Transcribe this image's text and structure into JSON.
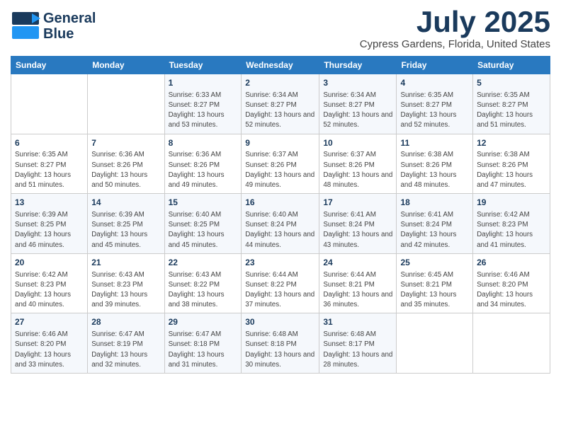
{
  "header": {
    "logo_line1": "General",
    "logo_line2": "Blue",
    "month": "July 2025",
    "location": "Cypress Gardens, Florida, United States"
  },
  "weekdays": [
    "Sunday",
    "Monday",
    "Tuesday",
    "Wednesday",
    "Thursday",
    "Friday",
    "Saturday"
  ],
  "weeks": [
    [
      {
        "day": "",
        "info": ""
      },
      {
        "day": "",
        "info": ""
      },
      {
        "day": "1",
        "info": "Sunrise: 6:33 AM\nSunset: 8:27 PM\nDaylight: 13 hours and 53 minutes."
      },
      {
        "day": "2",
        "info": "Sunrise: 6:34 AM\nSunset: 8:27 PM\nDaylight: 13 hours and 52 minutes."
      },
      {
        "day": "3",
        "info": "Sunrise: 6:34 AM\nSunset: 8:27 PM\nDaylight: 13 hours and 52 minutes."
      },
      {
        "day": "4",
        "info": "Sunrise: 6:35 AM\nSunset: 8:27 PM\nDaylight: 13 hours and 52 minutes."
      },
      {
        "day": "5",
        "info": "Sunrise: 6:35 AM\nSunset: 8:27 PM\nDaylight: 13 hours and 51 minutes."
      }
    ],
    [
      {
        "day": "6",
        "info": "Sunrise: 6:35 AM\nSunset: 8:27 PM\nDaylight: 13 hours and 51 minutes."
      },
      {
        "day": "7",
        "info": "Sunrise: 6:36 AM\nSunset: 8:26 PM\nDaylight: 13 hours and 50 minutes."
      },
      {
        "day": "8",
        "info": "Sunrise: 6:36 AM\nSunset: 8:26 PM\nDaylight: 13 hours and 49 minutes."
      },
      {
        "day": "9",
        "info": "Sunrise: 6:37 AM\nSunset: 8:26 PM\nDaylight: 13 hours and 49 minutes."
      },
      {
        "day": "10",
        "info": "Sunrise: 6:37 AM\nSunset: 8:26 PM\nDaylight: 13 hours and 48 minutes."
      },
      {
        "day": "11",
        "info": "Sunrise: 6:38 AM\nSunset: 8:26 PM\nDaylight: 13 hours and 48 minutes."
      },
      {
        "day": "12",
        "info": "Sunrise: 6:38 AM\nSunset: 8:26 PM\nDaylight: 13 hours and 47 minutes."
      }
    ],
    [
      {
        "day": "13",
        "info": "Sunrise: 6:39 AM\nSunset: 8:25 PM\nDaylight: 13 hours and 46 minutes."
      },
      {
        "day": "14",
        "info": "Sunrise: 6:39 AM\nSunset: 8:25 PM\nDaylight: 13 hours and 45 minutes."
      },
      {
        "day": "15",
        "info": "Sunrise: 6:40 AM\nSunset: 8:25 PM\nDaylight: 13 hours and 45 minutes."
      },
      {
        "day": "16",
        "info": "Sunrise: 6:40 AM\nSunset: 8:24 PM\nDaylight: 13 hours and 44 minutes."
      },
      {
        "day": "17",
        "info": "Sunrise: 6:41 AM\nSunset: 8:24 PM\nDaylight: 13 hours and 43 minutes."
      },
      {
        "day": "18",
        "info": "Sunrise: 6:41 AM\nSunset: 8:24 PM\nDaylight: 13 hours and 42 minutes."
      },
      {
        "day": "19",
        "info": "Sunrise: 6:42 AM\nSunset: 8:23 PM\nDaylight: 13 hours and 41 minutes."
      }
    ],
    [
      {
        "day": "20",
        "info": "Sunrise: 6:42 AM\nSunset: 8:23 PM\nDaylight: 13 hours and 40 minutes."
      },
      {
        "day": "21",
        "info": "Sunrise: 6:43 AM\nSunset: 8:23 PM\nDaylight: 13 hours and 39 minutes."
      },
      {
        "day": "22",
        "info": "Sunrise: 6:43 AM\nSunset: 8:22 PM\nDaylight: 13 hours and 38 minutes."
      },
      {
        "day": "23",
        "info": "Sunrise: 6:44 AM\nSunset: 8:22 PM\nDaylight: 13 hours and 37 minutes."
      },
      {
        "day": "24",
        "info": "Sunrise: 6:44 AM\nSunset: 8:21 PM\nDaylight: 13 hours and 36 minutes."
      },
      {
        "day": "25",
        "info": "Sunrise: 6:45 AM\nSunset: 8:21 PM\nDaylight: 13 hours and 35 minutes."
      },
      {
        "day": "26",
        "info": "Sunrise: 6:46 AM\nSunset: 8:20 PM\nDaylight: 13 hours and 34 minutes."
      }
    ],
    [
      {
        "day": "27",
        "info": "Sunrise: 6:46 AM\nSunset: 8:20 PM\nDaylight: 13 hours and 33 minutes."
      },
      {
        "day": "28",
        "info": "Sunrise: 6:47 AM\nSunset: 8:19 PM\nDaylight: 13 hours and 32 minutes."
      },
      {
        "day": "29",
        "info": "Sunrise: 6:47 AM\nSunset: 8:18 PM\nDaylight: 13 hours and 31 minutes."
      },
      {
        "day": "30",
        "info": "Sunrise: 6:48 AM\nSunset: 8:18 PM\nDaylight: 13 hours and 30 minutes."
      },
      {
        "day": "31",
        "info": "Sunrise: 6:48 AM\nSunset: 8:17 PM\nDaylight: 13 hours and 28 minutes."
      },
      {
        "day": "",
        "info": ""
      },
      {
        "day": "",
        "info": ""
      }
    ]
  ]
}
